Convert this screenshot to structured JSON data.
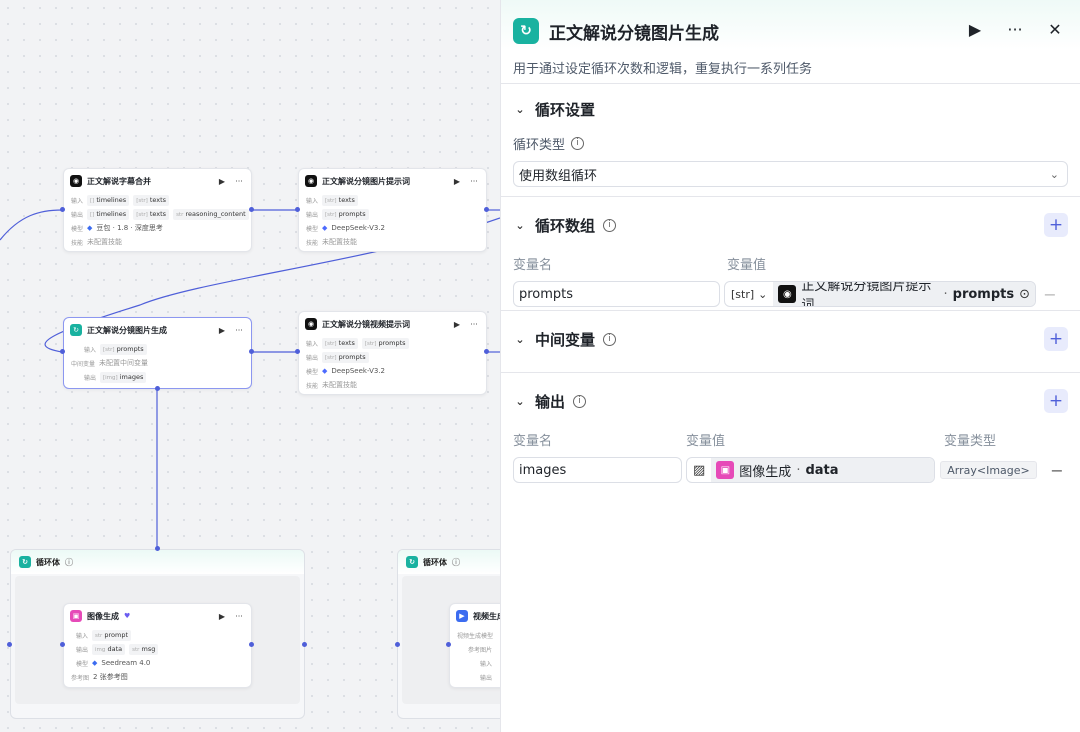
{
  "colors": {
    "accent": "#4f5fd9",
    "loop_teal": "#19b2a0",
    "image_pink": "#e64ab8"
  },
  "canvas": {
    "node1": {
      "title": "正文解说字幕合并",
      "in_label": "输入",
      "in_vars": [
        "timelines",
        "texts"
      ],
      "out_label": "输出",
      "out_vars": [
        "timelines",
        "texts",
        "reasoning_content"
      ],
      "model_label": "模型",
      "model": "豆包 · 1.8 · 深度思考",
      "skill_label": "技能",
      "skill": "未配置技能"
    },
    "node2": {
      "title": "正文解说分镜图片提示词",
      "in_label": "输入",
      "in_var": "texts",
      "out_label": "输出",
      "out_var": "prompts",
      "model_label": "模型",
      "model": "DeepSeek-V3.2",
      "skill_label": "技能",
      "skill": "未配置技能"
    },
    "node3": {
      "title": "正文解说分镜图片生成",
      "in_label": "输入",
      "in_var": "prompts",
      "mid_label": "中间变量",
      "mid": "未配置中间变量",
      "out_label": "输出",
      "out_var": "images"
    },
    "node4": {
      "title": "正文解说分镜视频提示词",
      "in_label": "输入",
      "in_vars": [
        "texts",
        "prompts"
      ],
      "out_label": "输出",
      "out_var": "prompts",
      "model_label": "模型",
      "model": "DeepSeek-V3.2",
      "skill_label": "技能",
      "skill": "未配置技能"
    },
    "loop1": {
      "title": "循环体"
    },
    "loop2": {
      "title": "循环体"
    },
    "imgnode": {
      "title": "图像生成",
      "in_label": "输入",
      "in_var": "prompt",
      "out_label": "输出",
      "out_vars": [
        "data",
        "msg"
      ],
      "model_label": "模型",
      "model": "Seedream 4.0",
      "ref_label": "参考图",
      "ref": "2 张参考图"
    },
    "vidnode": {
      "title": "视频生成",
      "row1": "视频生成模型",
      "row2": "参考图片",
      "row3": "输入",
      "row4": "输出"
    }
  },
  "panel": {
    "title": "正文解说分镜图片生成",
    "description": "用于通过设定循环次数和逻辑，重复执行一系列任务",
    "loop_settings": {
      "title": "循环设置",
      "type_label": "循环类型",
      "type_value": "使用数组循环"
    },
    "loop_array": {
      "title": "循环数组",
      "col_name": "变量名",
      "col_value": "变量值",
      "rows": [
        {
          "name": "prompts",
          "type": "[str]",
          "ref_node": "正文解说分镜图片提示词",
          "ref_sep": " · ",
          "ref_var": "prompts"
        }
      ]
    },
    "middle_vars": {
      "title": "中间变量"
    },
    "output": {
      "title": "输出",
      "col_name": "变量名",
      "col_value": "变量值",
      "col_type": "变量类型",
      "rows": [
        {
          "name": "images",
          "ref_node": "图像生成",
          "ref_sep": " · ",
          "ref_var": "data",
          "type": "Array<Image>"
        }
      ]
    }
  }
}
